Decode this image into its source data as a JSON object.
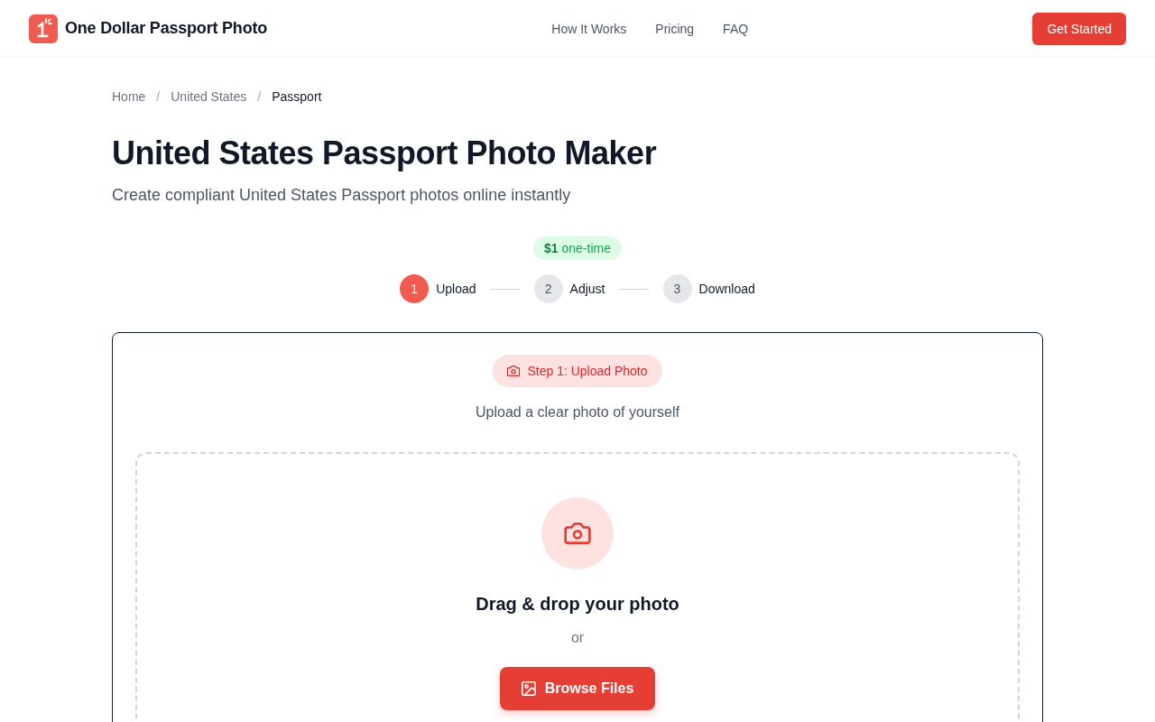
{
  "header": {
    "brand": "One Dollar Passport Photo",
    "nav": [
      "How It Works",
      "Pricing",
      "FAQ"
    ],
    "cta": "Get Started"
  },
  "breadcrumb": {
    "separator": "/",
    "items": [
      {
        "label": "Home",
        "current": false
      },
      {
        "label": "United States",
        "current": false
      },
      {
        "label": "Passport",
        "current": true
      }
    ]
  },
  "title": "United States Passport Photo Maker",
  "subtitle": "Create compliant United States Passport photos online instantly",
  "price_badge": "**$1** one-time",
  "steps": [
    {
      "number": "1",
      "label": "Upload",
      "selected": true
    },
    {
      "number": "2",
      "label": "Adjust",
      "selected": false
    },
    {
      "number": "3",
      "label": "Download",
      "selected": false
    }
  ],
  "upload_card": {
    "step_pill": "Step 1: Upload Photo",
    "instruction": "Upload a clear photo of yourself",
    "dropzone": {
      "heading": "Drag & drop your photo",
      "or_text": "or",
      "button": "Browse Files"
    }
  }
}
